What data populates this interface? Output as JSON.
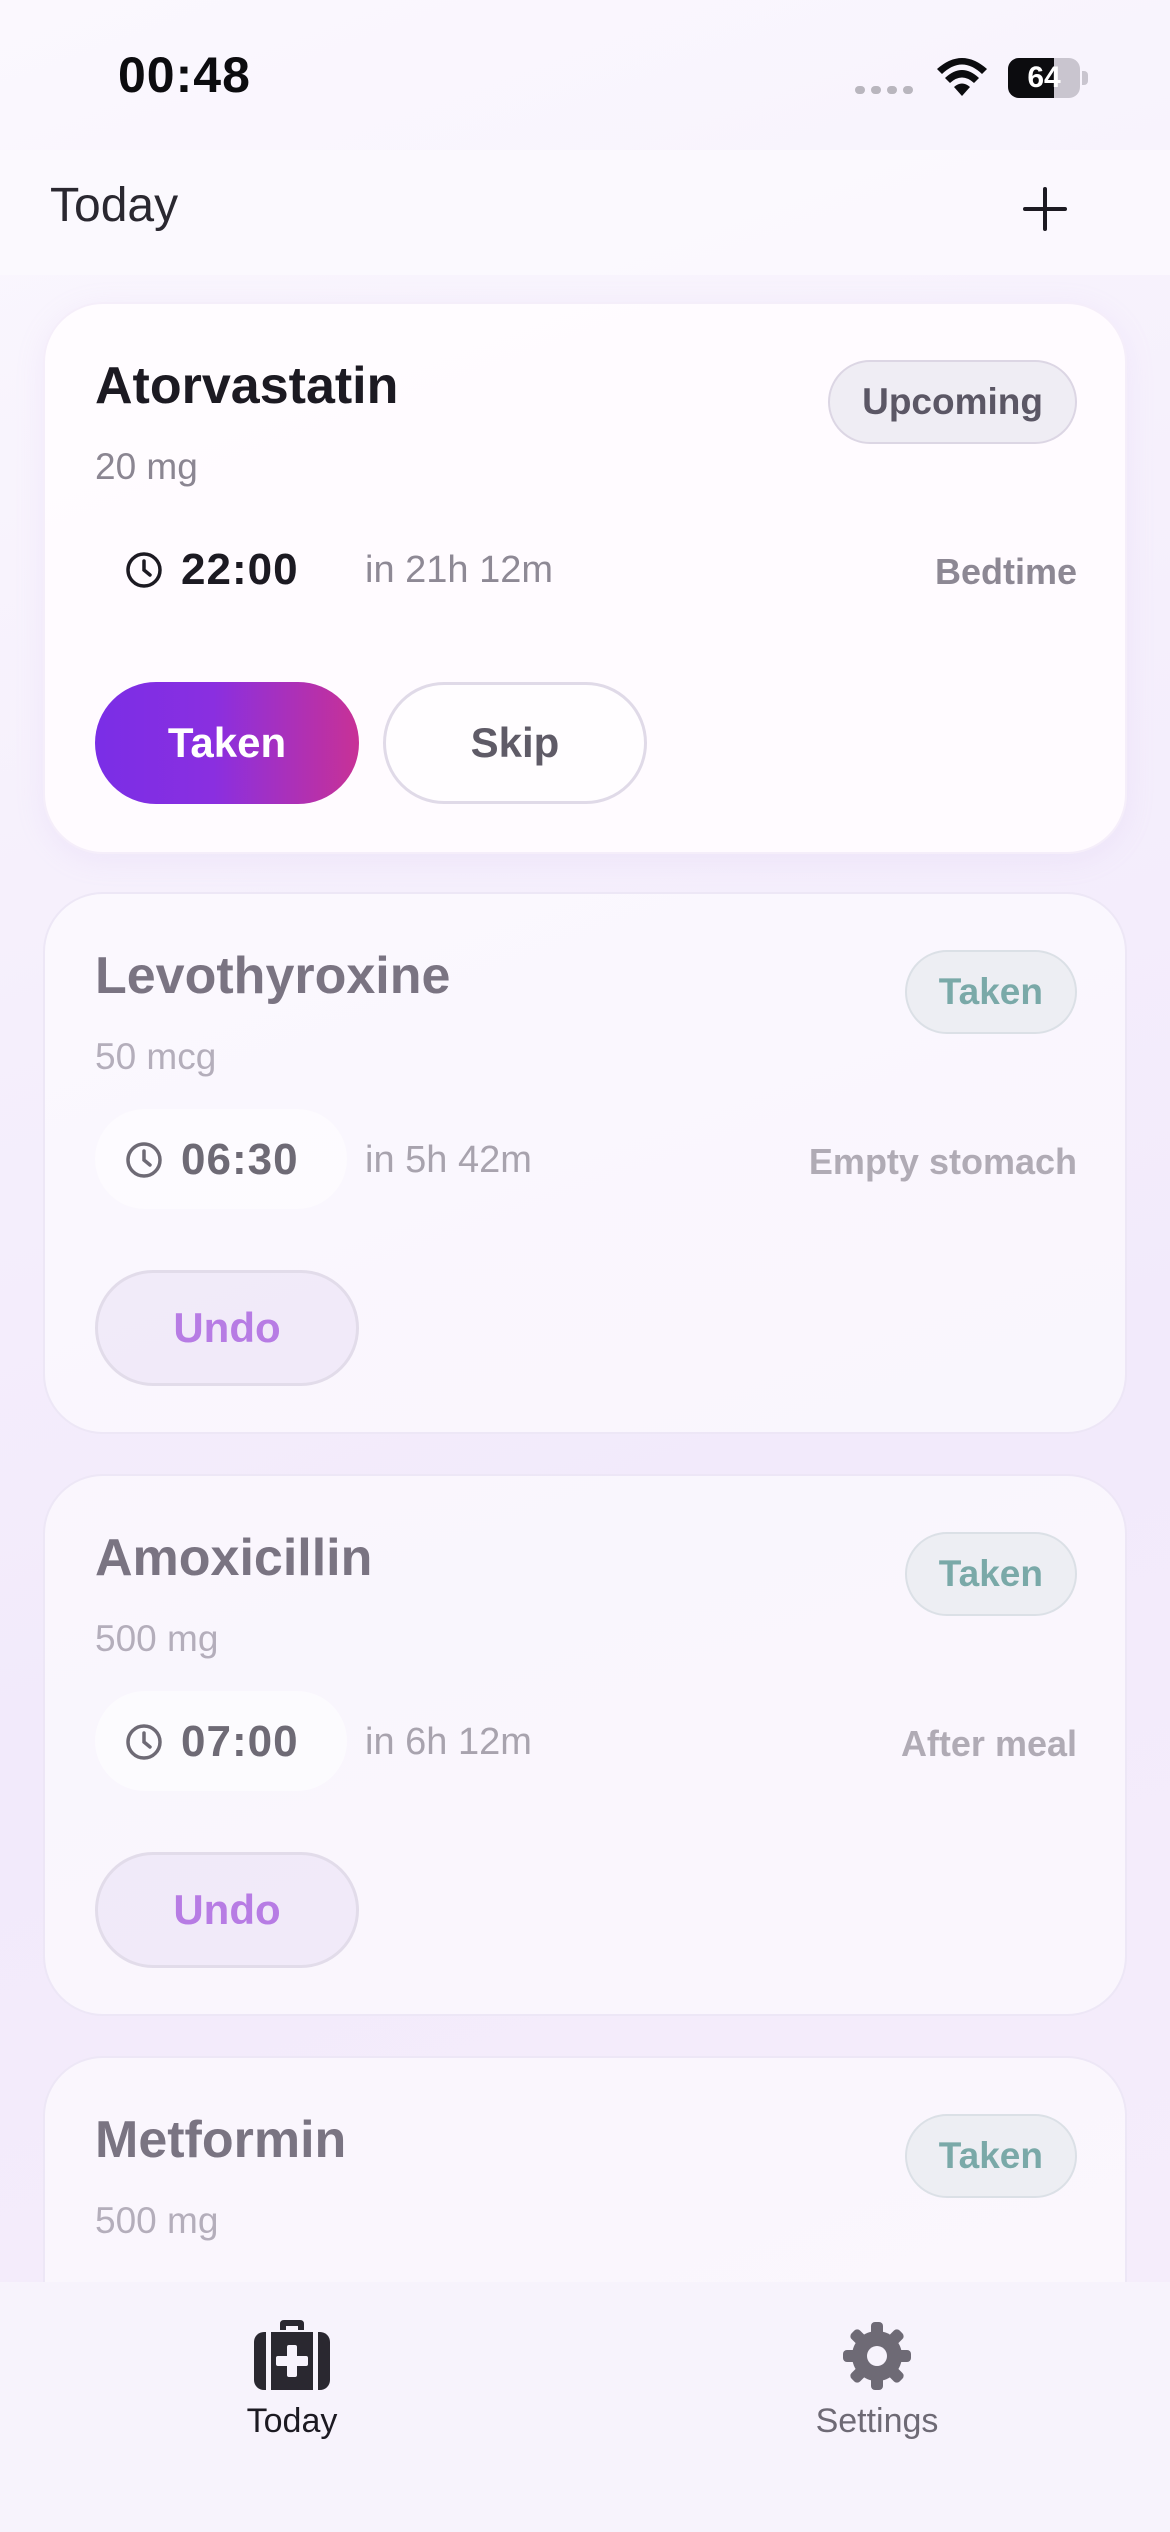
{
  "status_bar": {
    "time": "00:48",
    "battery": "64"
  },
  "header": {
    "title": "Today",
    "add_icon": "plus-icon"
  },
  "meds": [
    {
      "name": "Atorvastatin",
      "dose": "20 mg",
      "status": "Upcoming",
      "time": "22:00",
      "relative": "in 21h 12m",
      "tag": "Bedtime",
      "primary_action": "Taken",
      "secondary_action": "Skip"
    },
    {
      "name": "Levothyroxine",
      "dose": "50 mcg",
      "status": "Taken",
      "time": "06:30",
      "relative": "in 5h 42m",
      "tag": "Empty stomach",
      "action": "Undo"
    },
    {
      "name": "Amoxicillin",
      "dose": "500 mg",
      "status": "Taken",
      "time": "07:00",
      "relative": "in 6h 12m",
      "tag": "After meal",
      "action": "Undo"
    },
    {
      "name": "Metformin",
      "dose": "500 mg",
      "status": "Taken"
    }
  ],
  "tabs": [
    {
      "label": "Today",
      "icon": "medical-kit-icon",
      "active": true
    },
    {
      "label": "Settings",
      "icon": "gear-icon",
      "active": false
    }
  ],
  "colors": {
    "accent_start": "#7a2ee6",
    "accent_end": "#c83196",
    "taken_text": "#7aa9a8",
    "undo_text": "#b77ce4"
  }
}
